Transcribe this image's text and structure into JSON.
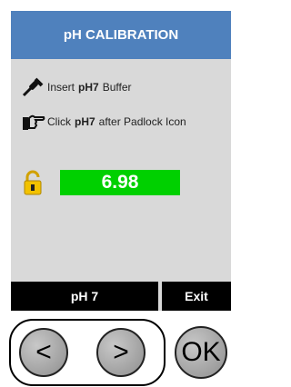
{
  "header": {
    "title": "pH CALIBRATION"
  },
  "instructions": {
    "line1": {
      "prefix": "Insert",
      "bold": "pH7",
      "suffix": "Buffer"
    },
    "line2": {
      "prefix": "Click",
      "bold": "pH7",
      "suffix": "after Padlock Icon"
    }
  },
  "reading": {
    "value": "6.98"
  },
  "buttons": {
    "ph7": "pH 7",
    "exit": "Exit"
  },
  "nav": {
    "prev": "<",
    "next": ">",
    "ok": "OK"
  },
  "colors": {
    "header": "#4f81bd",
    "screen": "#d9d9d9",
    "reading": "#00d000",
    "lock": "#f2c200"
  },
  "icons": {
    "dropper": "dropper-icon",
    "hand": "pointing-hand-icon",
    "lock": "padlock-icon"
  }
}
